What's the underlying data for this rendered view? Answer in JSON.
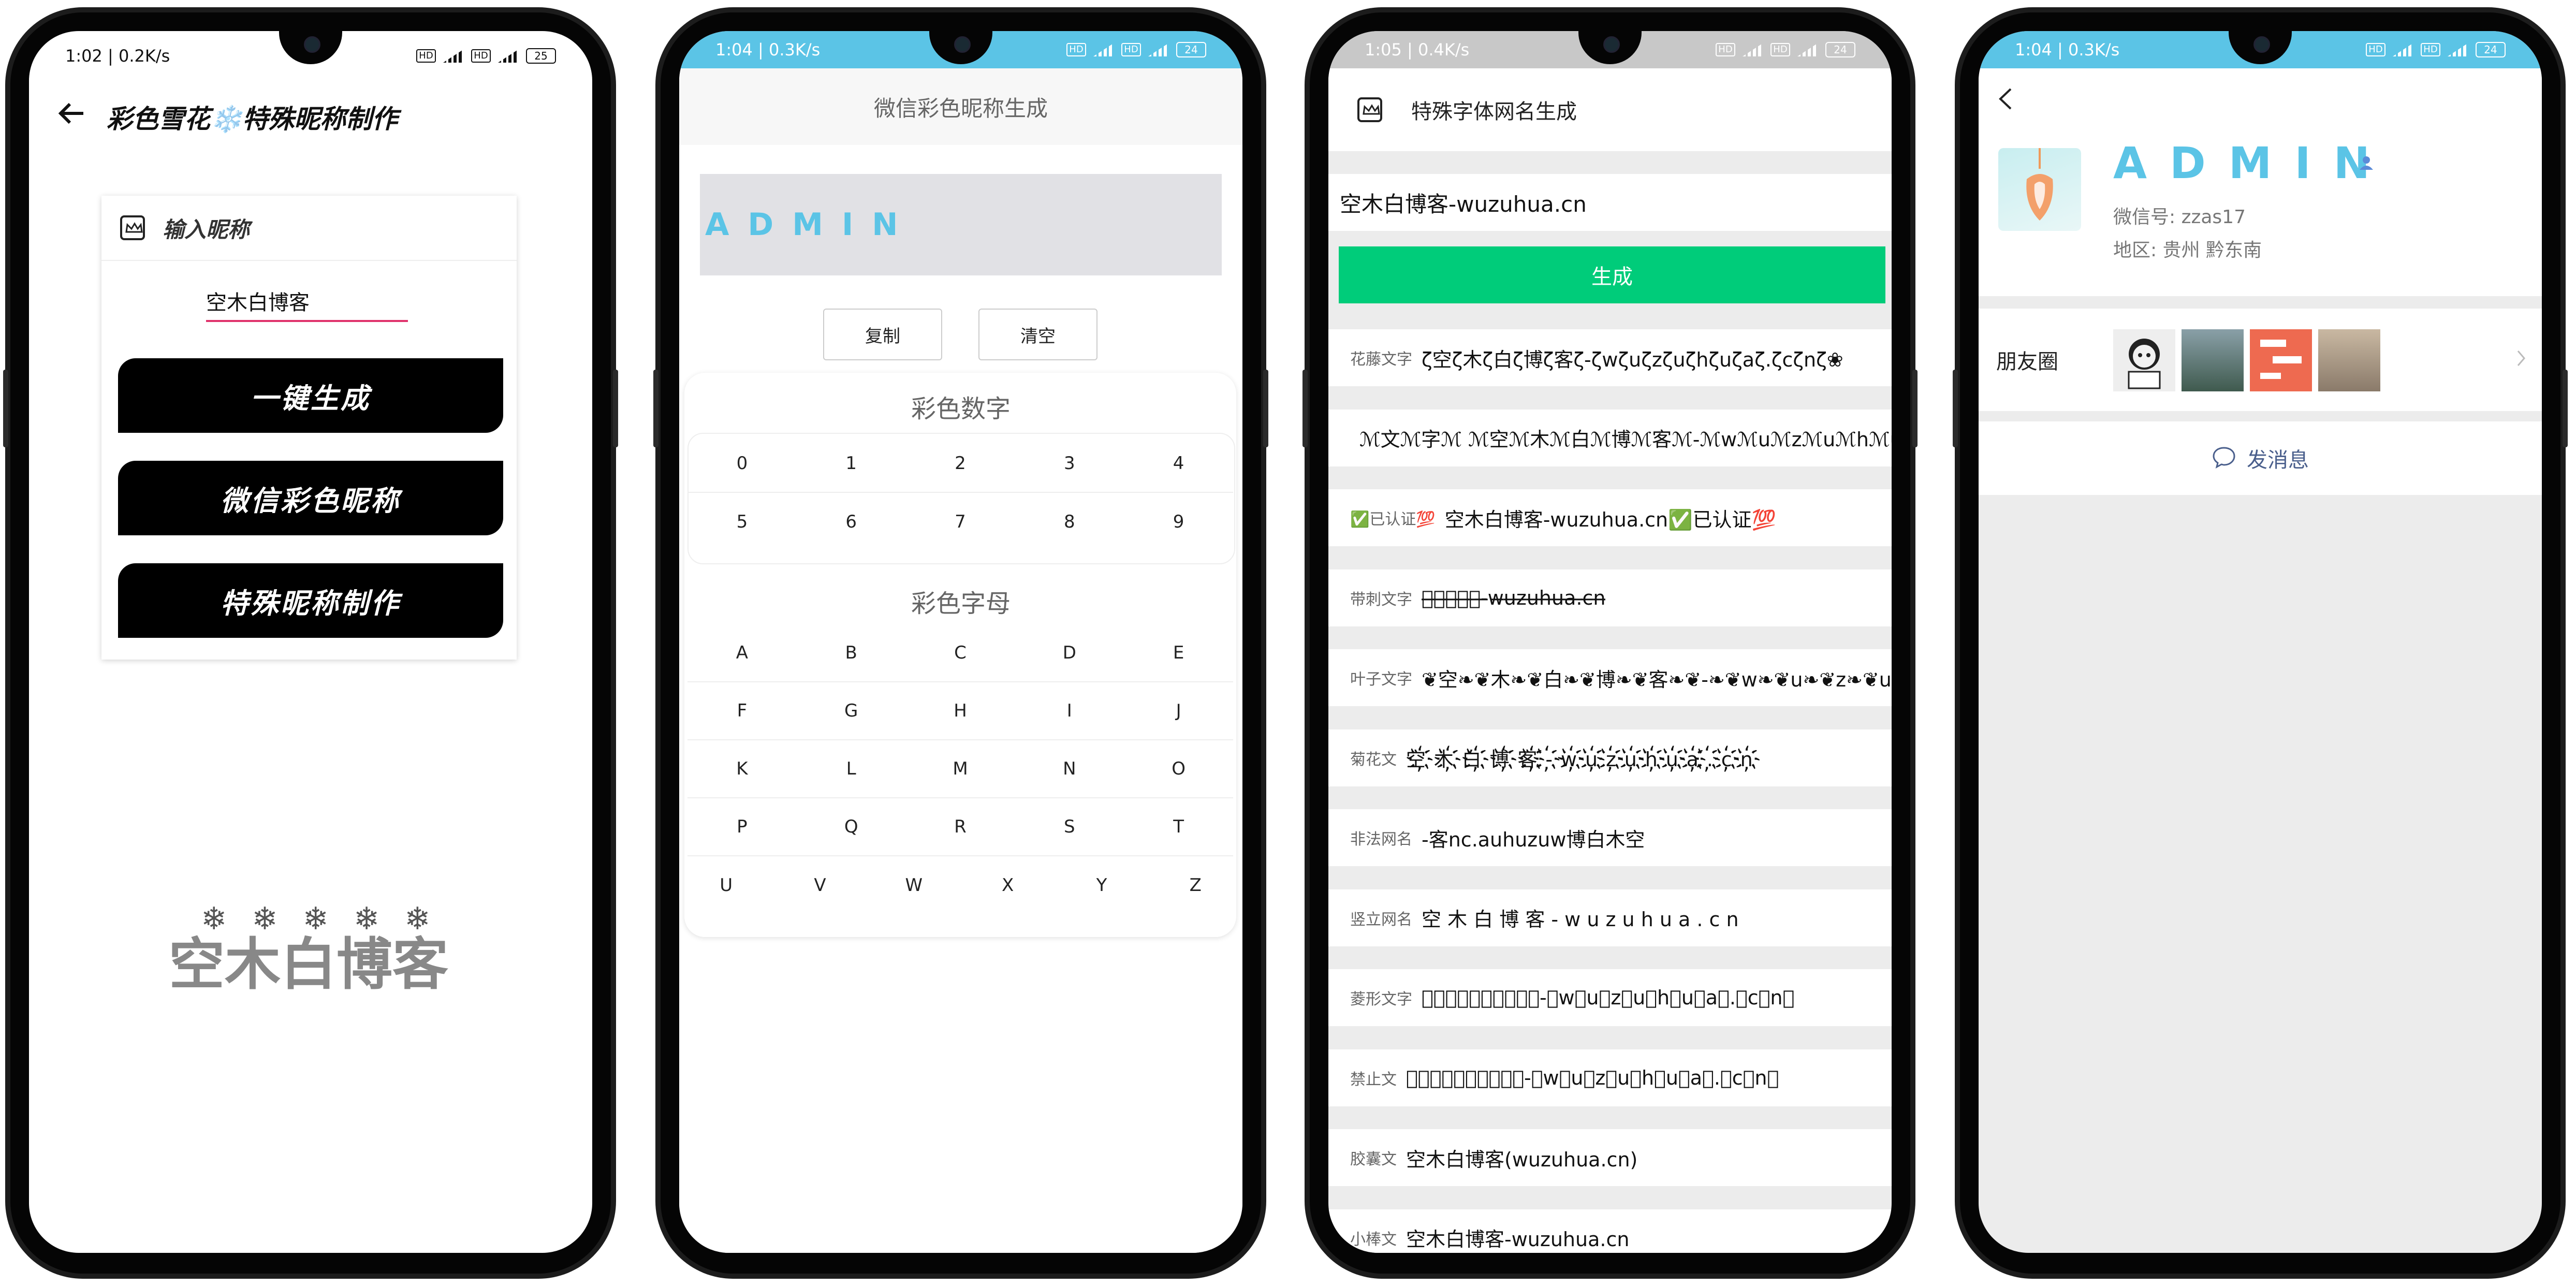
{
  "screen1": {
    "status_time": "1:02 | 0.2K/s",
    "battery": "25",
    "title": "彩色雪花❄️特殊昵称制作",
    "card_header": "输入昵称",
    "input_value": "空木白博客",
    "buttons": [
      "一键生成",
      "微信彩色昵称",
      "特殊昵称制作"
    ],
    "snow_text": "空木白博客"
  },
  "screen2": {
    "status_time": "1:04 | 0.3K/s",
    "battery": "24",
    "title": "微信彩色昵称生成",
    "preview": "ADMIN",
    "copy_button": "复制",
    "clear_button": "清空",
    "digits_title": "彩色数字",
    "digits": [
      "0",
      "1",
      "2",
      "3",
      "4",
      "5",
      "6",
      "7",
      "8",
      "9"
    ],
    "letters_title": "彩色字母",
    "letters": [
      "A",
      "B",
      "C",
      "D",
      "E",
      "F",
      "G",
      "H",
      "I",
      "J",
      "K",
      "L",
      "M",
      "N",
      "O",
      "P",
      "Q",
      "R",
      "S",
      "T",
      "U",
      "V",
      "W",
      "X",
      "Y",
      "Z"
    ],
    "accent": "#5bc4e6"
  },
  "screen3": {
    "status_time": "1:05 | 0.4K/s",
    "battery": "24",
    "title": "特殊字体网名生成",
    "input_value": "空木白博客-wuzuhua.cn",
    "generate_button": "生成",
    "generate_color": "#00cc7a",
    "rows": [
      {
        "label": "花藤文字",
        "value": "ζ空ζ木ζ白ζ博ζ客ζ-ζwζuζzζuζhζuζaζ.ζcζnζ❀"
      },
      {
        "label": "",
        "value": "ℳ文ℳ字ℳ ℳ空ℳ木ℳ白ℳ博ℳ客ℳ-ℳwℳuℳzℳuℳhℳuℳaℳ.ℳcℳn"
      },
      {
        "label": "✅已认证💯",
        "value": "空木白博客-wuzuhua.cn✅已认证💯"
      },
      {
        "label": "带刺文字",
        "value": "空̶木̶白̶博̶客̶-̶w̶u̶z̶u̶h̶u̶a̶.̶c̶n̶"
      },
      {
        "label": "叶子文字",
        "value": "❦空❧❦木❧❦白❧❦博❧❦客❧❦-❧❦w❧❦u❧❦z❧❦u❧❦h❧❦u❧❦a"
      },
      {
        "label": "菊花文",
        "value": "空҉木҉白҉博҉客҉-҉w҉u҉z҉u҉h҉u҉a҉.҉c҉n҉"
      },
      {
        "label": "非法网名",
        "value": "-客nc.auhuzuw博白木空"
      },
      {
        "label": "竖立网名",
        "value": "空 木 白 博 客 - w u z u h u a . c n"
      },
      {
        "label": "菱形文字",
        "value": "空⃟木⃟白⃟博⃟客⃟-⃟w⃟u⃟z⃟u⃟h⃟u⃟a⃟.⃟c⃟n⃟"
      },
      {
        "label": "禁止文",
        "value": "空⃠木⃠白⃠博⃠客⃠-⃠w⃠u⃠z⃠u⃠h⃠u⃠a⃠.⃠c⃠n⃠"
      },
      {
        "label": "胶囊文",
        "value": "空木白博客(wuzuhua.cn)"
      },
      {
        "label": "小棒文",
        "value": "空木白博客-wuzuhua.cn"
      }
    ]
  },
  "screen4": {
    "status_time": "1:04 | 0.3K/s",
    "battery": "24",
    "name": "ADMIN",
    "wechat_id": "微信号:  zzas17",
    "region": "地区:  贵州  黔东南",
    "moments_label": "朋友圈",
    "send_message": "发消息",
    "accent": "#5bc4e6",
    "link_color": "#4a5f8c"
  }
}
